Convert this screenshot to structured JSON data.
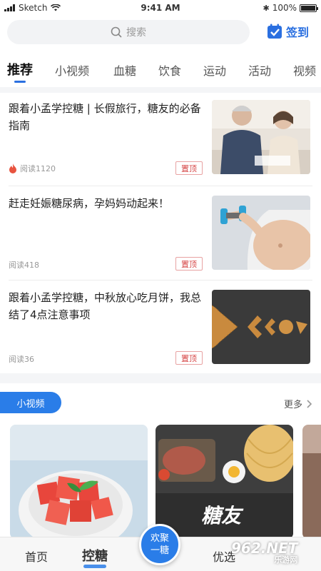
{
  "status_bar": {
    "carrier": "Sketch",
    "time": "9:41 AM",
    "battery": "100%"
  },
  "search": {
    "placeholder": "搜索"
  },
  "checkin": {
    "label": "签到"
  },
  "tabs": [
    "推荐",
    "小视频",
    "血糖",
    "饮食",
    "运动",
    "活动",
    "视频"
  ],
  "articles": [
    {
      "title": "跟着小孟学控糖 | 长假旅行，糖友的必备指南",
      "reads": "阅读1120",
      "pin": "置顶",
      "hot": true,
      "image": "elderly-couple-photo"
    },
    {
      "title": "赶走妊娠糖尿病，孕妈妈动起来！",
      "reads": "阅读418",
      "pin": "置顶",
      "hot": false,
      "image": "pregnant-woman-dumbbell-photo"
    },
    {
      "title": "跟着小孟学控糖，中秋放心吃月饼，我总结了4点注意事项",
      "reads": "阅读36",
      "pin": "置顶",
      "hot": false,
      "image": "mooncake-pieces-photo"
    }
  ],
  "video_section": {
    "title": "小视频",
    "more": "更多",
    "cards": [
      {
        "image": "watermelon-bowl-photo"
      },
      {
        "image": "meal-plate-photo",
        "overlay_text": "糖友"
      },
      {
        "image": "partial-card"
      }
    ]
  },
  "bottom_nav": {
    "items": [
      "首页",
      "控糖",
      "优选"
    ],
    "active": "控糖",
    "center_button": {
      "line1": "欢聚",
      "line2": "一糖"
    }
  },
  "watermark": {
    "text": "962.NET",
    "sub": "乐游网"
  },
  "colors": {
    "accent": "#2a7de8",
    "pin": "#d64545"
  }
}
